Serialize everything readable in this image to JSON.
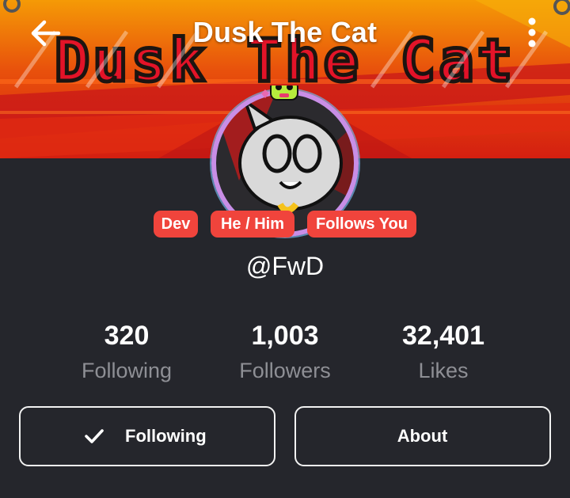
{
  "header": {
    "title": "Dusk The Cat",
    "banner_text": "Dusk The Cat",
    "back_icon": "arrow-left-icon",
    "more_icon": "more-vertical-icon"
  },
  "profile": {
    "badges": [
      "Dev",
      "He / Him",
      "Follows You"
    ],
    "username": "@FwD"
  },
  "stats": [
    {
      "value": "320",
      "label": "Following"
    },
    {
      "value": "1,003",
      "label": "Followers"
    },
    {
      "value": "32,401",
      "label": "Likes"
    }
  ],
  "actions": {
    "following_label": "Following",
    "following_icon": "checkmark-icon",
    "about_label": "About"
  },
  "colors": {
    "background": "#25262c",
    "badge": "#f0443c",
    "muted_text": "#8e8f95",
    "avatar_ring": "#c98ee6"
  }
}
